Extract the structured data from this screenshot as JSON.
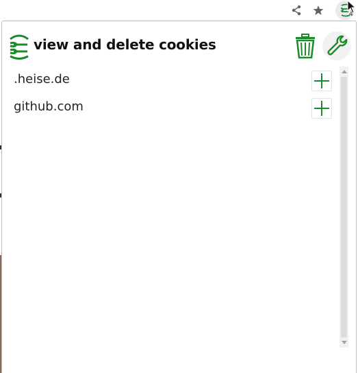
{
  "toolbar": {
    "share_icon": "share-icon",
    "star_icon": "star-icon",
    "extension_icon": "cookie-extension-icon",
    "extension_badge": "4"
  },
  "popup": {
    "title": "view and delete cookies",
    "logo_icon": "cookie-logo-icon",
    "delete_all_icon": "trash-icon",
    "settings_icon": "wrench-icon",
    "accent_color": "#1a8a2a",
    "domains": [
      {
        "label": ".heise.de",
        "action_icon": "plus-icon"
      },
      {
        "label": "github.com",
        "action_icon": "plus-icon"
      }
    ]
  }
}
